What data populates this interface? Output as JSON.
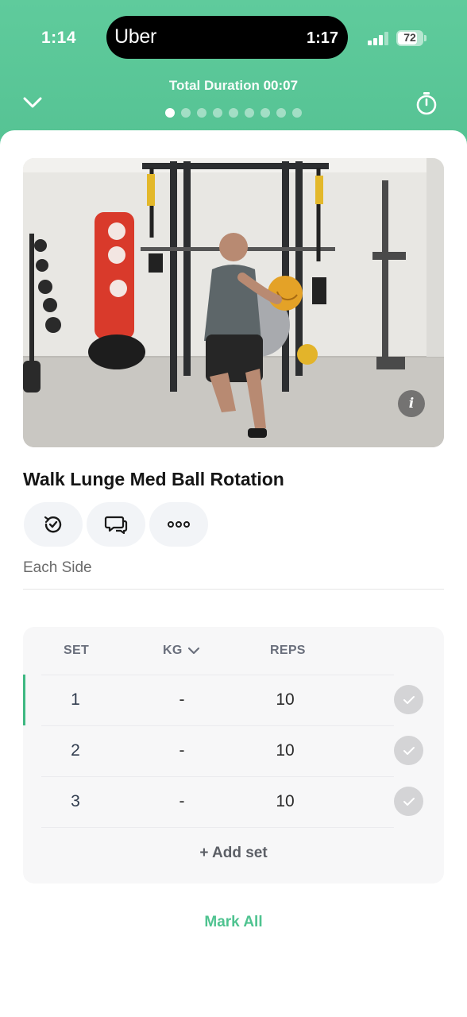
{
  "status_bar": {
    "time": "1:14",
    "island_app": "Uber",
    "island_time": "1:17",
    "battery": "72"
  },
  "header": {
    "duration_label": "Total Duration",
    "duration_value": "00:07",
    "page_count": 9,
    "active_page": 0
  },
  "exercise": {
    "title": "Walk Lunge Med Ball Rotation",
    "note": "Each Side",
    "info_glyph": "i"
  },
  "actions": [
    {
      "icon": "history-icon"
    },
    {
      "icon": "comment-icon"
    },
    {
      "icon": "more-icon",
      "label": "•••"
    }
  ],
  "table": {
    "headers": {
      "set": "SET",
      "kg": "KG",
      "reps": "REPS"
    },
    "rows": [
      {
        "set": "1",
        "kg": "-",
        "reps": "10",
        "active": true
      },
      {
        "set": "2",
        "kg": "-",
        "reps": "10",
        "active": false
      },
      {
        "set": "3",
        "kg": "-",
        "reps": "10",
        "active": false
      }
    ],
    "add_set_label": "+ Add set"
  },
  "mark_all_label": "Mark All",
  "colors": {
    "header_green": "#5cc79a",
    "accent_green": "#4fc390",
    "check_grey": "#d4d4d6"
  }
}
